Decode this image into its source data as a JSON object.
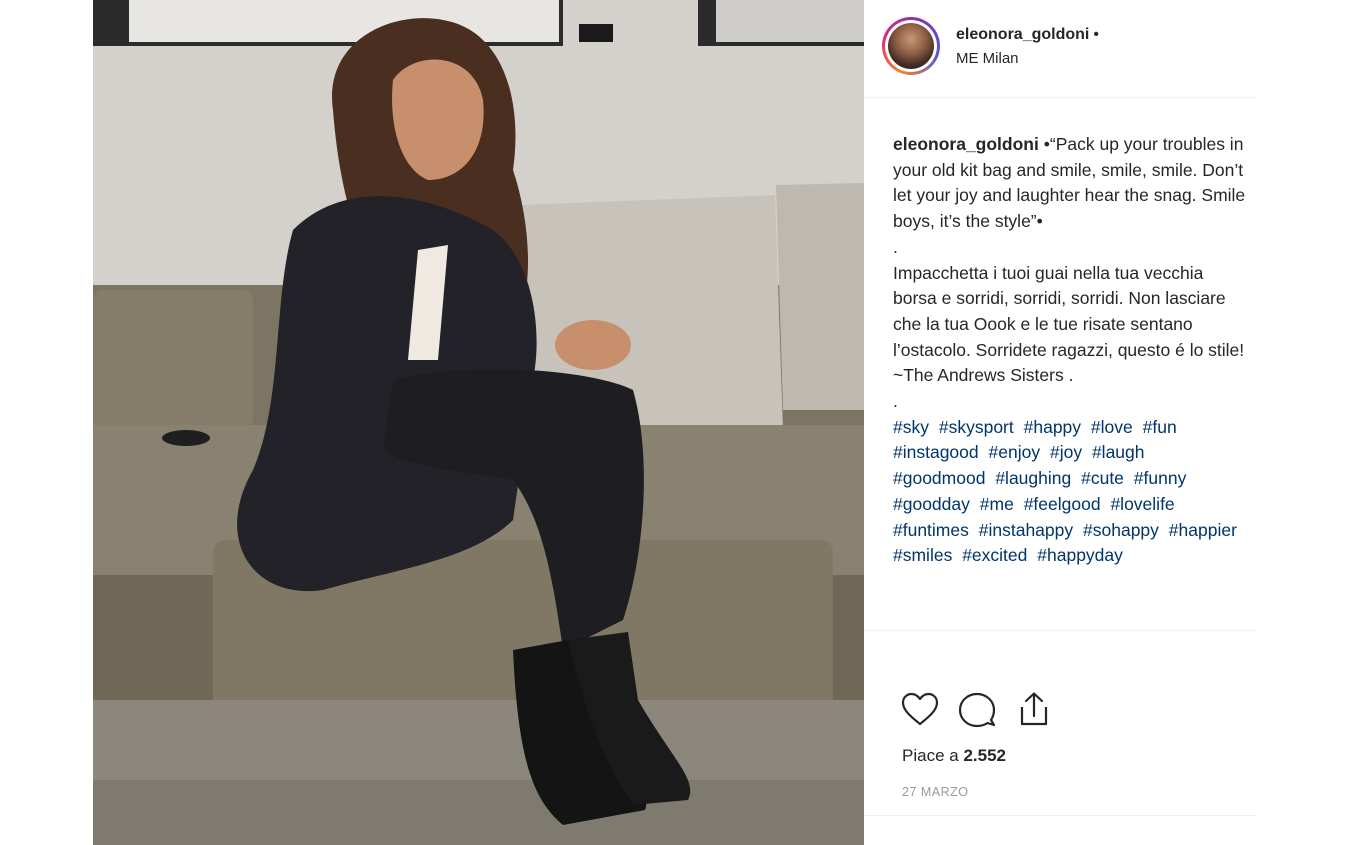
{
  "post": {
    "username": "eleonora_goldoni",
    "separator": "•",
    "location": "ME Milan",
    "caption": {
      "username": "eleonora_goldoni",
      "english": "•“Pack up your troubles in your old kit bag and smile, smile, smile. Don’t let your joy and laughter hear the snag. Smile boys, it’s the style”•",
      "dot1": ".",
      "italian": "Impacchetta i tuoi guai nella tua vecchia borsa e sorridi, sorridi, sorridi. Non lasciare che la tua Oook e le tue risate sentano l’ostacolo. Sorridete ragazzi, questo é lo stile! ~The Andrews Sisters .",
      "dot2": ".",
      "hashtags": [
        "#sky",
        "#skysport",
        "#happy",
        "#love",
        "#fun",
        "#instagood",
        "#enjoy",
        "#joy",
        "#laugh",
        "#goodmood",
        "#laughing",
        "#cute",
        "#funny",
        "#goodday",
        "#me",
        "#feelgood",
        "#lovelife",
        "#funtimes",
        "#instahappy",
        "#sohappy",
        "#happier",
        "#smiles",
        "#excited",
        "#happyday"
      ]
    },
    "likes_label": "Piace a",
    "likes_count": "2.552",
    "date": "27 MARZO"
  },
  "icons": {
    "like": "heart-icon",
    "comment": "comment-icon",
    "share": "share-icon"
  },
  "colors": {
    "hashtag": "#003569",
    "text": "#262626",
    "muted": "#999999",
    "divider": "#efefef"
  }
}
